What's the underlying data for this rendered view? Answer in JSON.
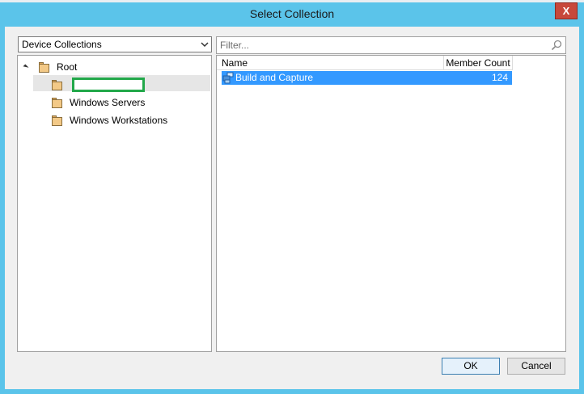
{
  "window": {
    "title": "Select Collection",
    "close_glyph": "X"
  },
  "collection_type": {
    "selected": "Device Collections"
  },
  "tree": {
    "root_label": "Root",
    "items": [
      {
        "label": ""
      },
      {
        "label": "Windows Servers"
      },
      {
        "label": "Windows Workstations"
      }
    ]
  },
  "filter": {
    "placeholder": "Filter..."
  },
  "list": {
    "columns": [
      "Name",
      "Member Count"
    ],
    "rows": [
      {
        "name": "Build and Capture",
        "member_count": "124",
        "icon": "collection-icon"
      }
    ]
  },
  "buttons": {
    "ok": "OK",
    "cancel": "Cancel"
  },
  "colors": {
    "title_bar": "#5bc4ea",
    "selection": "#3399ff",
    "close": "#c7483b",
    "redaction_box": "#22a84a"
  }
}
